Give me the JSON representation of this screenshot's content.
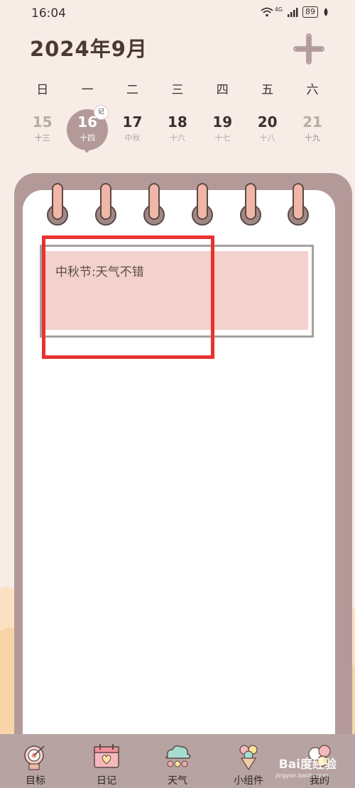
{
  "status_bar": {
    "time": "16:04",
    "network": "4G",
    "battery": "89",
    "icons": [
      "wifi-icon",
      "signal-icon",
      "battery-icon",
      "leaf-icon"
    ]
  },
  "header": {
    "month_title": "2024年9月",
    "add_icon": "plus-icon"
  },
  "weekdays": [
    "日",
    "一",
    "二",
    "三",
    "四",
    "五",
    "六"
  ],
  "dates": [
    {
      "day": "15",
      "lunar": "十三",
      "state": "muted"
    },
    {
      "day": "16",
      "lunar": "十四",
      "state": "selected",
      "badge": "记"
    },
    {
      "day": "17",
      "lunar": "中秋",
      "state": "normal"
    },
    {
      "day": "18",
      "lunar": "十六",
      "state": "normal"
    },
    {
      "day": "19",
      "lunar": "十七",
      "state": "normal"
    },
    {
      "day": "20",
      "lunar": "十八",
      "state": "normal"
    },
    {
      "day": "21",
      "lunar": "十九",
      "state": "muted"
    }
  ],
  "diary": {
    "entry_text": "中秋节:天气不错"
  },
  "tabs": [
    {
      "label": "目标",
      "icon": "target-icon"
    },
    {
      "label": "日记",
      "icon": "diary-icon"
    },
    {
      "label": "天气",
      "icon": "weather-icon"
    },
    {
      "label": "小组件",
      "icon": "widget-icon"
    },
    {
      "label": "我的",
      "icon": "profile-icon"
    }
  ],
  "watermark": {
    "text": "Bai度经验",
    "sub": "jingyan.baidu.com"
  },
  "colors": {
    "background": "#f7ece6",
    "accent": "#b39a99",
    "note_fill": "#f3d1cc",
    "ring": "#f0b6a6",
    "highlight": "#e8332e",
    "tab_bar": "#b7a3a1"
  }
}
